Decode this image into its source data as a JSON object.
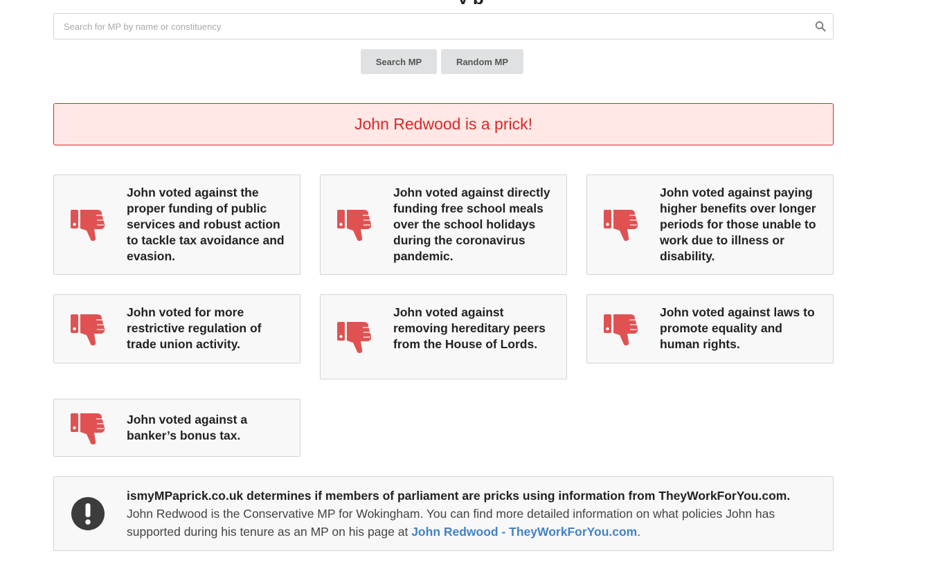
{
  "page": {
    "title_fragment": "y    p"
  },
  "search": {
    "placeholder": "Search for MP by name or constituency"
  },
  "buttons": {
    "search_label": "Search MP",
    "random_label": "Random MP"
  },
  "alert": {
    "text": "John Redwood is a prick!"
  },
  "votes": [
    {
      "text": "John voted against the proper funding of public services and robust action to tackle tax avoidance and evasion.",
      "icon": "thumbs-down-icon"
    },
    {
      "text": "John voted against directly funding free school meals over the school holidays during the coronavirus pandemic.",
      "icon": "thumbs-down-icon"
    },
    {
      "text": "John voted against paying higher benefits over longer periods for those unable to work due to illness or disability.",
      "icon": "thumbs-down-icon"
    },
    {
      "text": "John voted for more restrictive regulation of trade union activity.",
      "icon": "thumbs-down-icon"
    },
    {
      "text": "John voted against removing hereditary peers from the House of Lords.",
      "icon": "thumbs-down-icon"
    },
    {
      "text": "John voted against laws to promote equality and human rights.",
      "icon": "thumbs-down-icon"
    },
    {
      "text": "John voted against a banker’s bonus tax.",
      "icon": "thumbs-down-icon"
    }
  ],
  "info": {
    "icon": "exclamation-circle-icon",
    "header": "ismyMPaprick.co.uk determines if members of parliament are pricks using information from TheyWorkForYou.com.",
    "body": "John Redwood is the Conservative MP for Wokingham. You can find more detailed information on what policies John has supported during his tenure as an MP on his page at ",
    "link_text": "John Redwood - TheyWorkForYou.com",
    "trailing": "."
  },
  "colors": {
    "accent_red": "#db2828",
    "icon_red": "#e05252",
    "link_blue": "#4183c4"
  }
}
